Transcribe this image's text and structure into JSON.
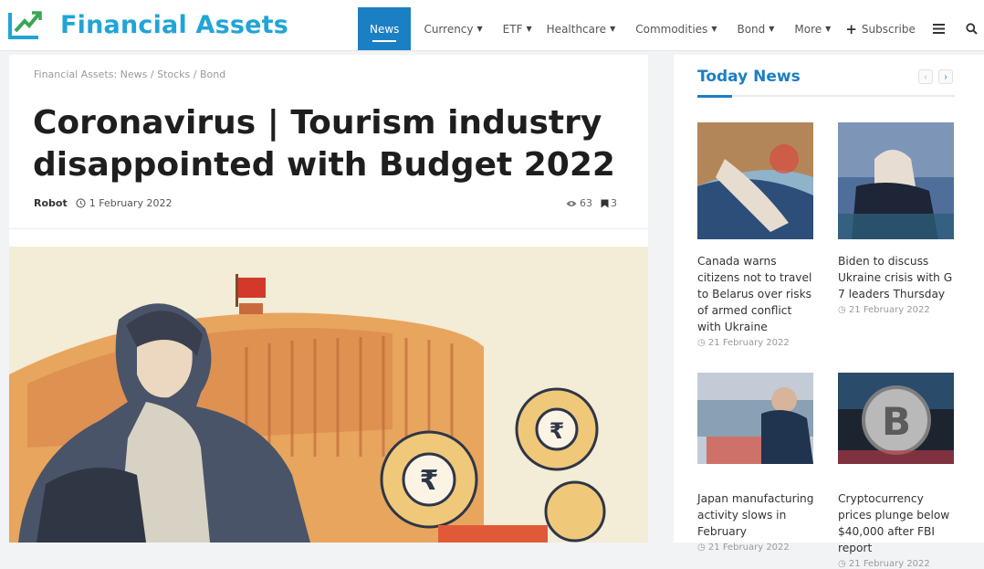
{
  "site": {
    "name": "Financial Assets"
  },
  "nav": {
    "items": [
      {
        "label": "News",
        "active": true
      },
      {
        "label": "Currency",
        "dropdown": true
      },
      {
        "label": "ETF",
        "dropdown": true
      },
      {
        "label": "Healthcare",
        "dropdown": true
      },
      {
        "label": "Commodities",
        "dropdown": true
      },
      {
        "label": "Bond",
        "dropdown": true
      },
      {
        "label": "More",
        "dropdown": true
      }
    ],
    "subscribe_label": "Subscribe",
    "icons": [
      "menu-icon",
      "search-icon"
    ]
  },
  "article": {
    "breadcrumb": "Financial Assets: News / Stocks / Bond",
    "title": "Coronavirus | Tourism industry disappointed with Budget 2022",
    "author": "Robot",
    "date": "1 February 2022",
    "views": "63",
    "comments": "3"
  },
  "sidebar": {
    "title": "Today News",
    "cards": [
      {
        "title": "Canada warns citizens not to travel to Belarus over risks of armed conflict with Ukraine",
        "date": "21 February 2022"
      },
      {
        "title": "Biden to discuss Ukraine crisis with G 7 leaders Thursday",
        "date": "21 February 2022"
      },
      {
        "title": "Japan manufacturing activity slows in February",
        "date": "21 February 2022"
      },
      {
        "title": "Cryptocurrency prices plunge below $40,000 after FBI report",
        "date": "21 February 2022"
      }
    ]
  },
  "colors": {
    "brand": "#21a4d6",
    "accent": "#1b7fc4",
    "logo_green": "#3aa655"
  }
}
